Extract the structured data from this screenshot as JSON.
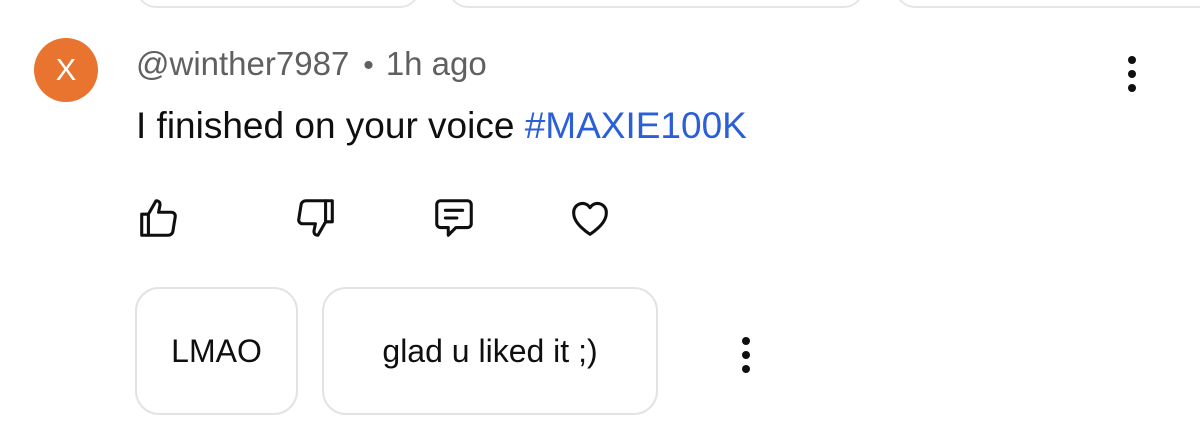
{
  "comment": {
    "avatar_letter": "X",
    "avatar_color": "#e8742f",
    "username": "@winther7987",
    "separator": "•",
    "timestamp": "1h ago",
    "text": "I finished on your voice ",
    "hashtag": "#MAXIE100K",
    "hashtag_color": "#2b5fd9"
  },
  "actions": {
    "like_icon": "thumbs-up-icon",
    "dislike_icon": "thumbs-down-icon",
    "reply_icon": "comment-icon",
    "heart_icon": "heart-icon",
    "more_icon": "more-vertical-icon"
  },
  "suggested_replies": [
    {
      "label": "LMAO"
    },
    {
      "label": "glad u liked it ;)"
    }
  ]
}
